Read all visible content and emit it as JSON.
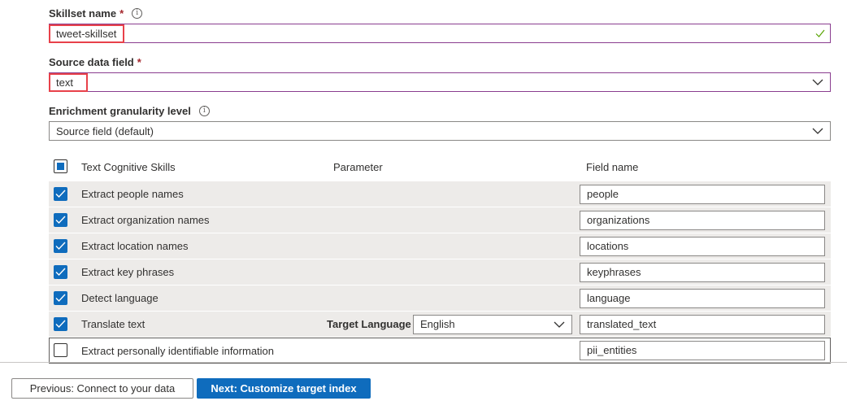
{
  "form": {
    "skillset_name": {
      "label": "Skillset name",
      "required_mark": "*",
      "value": "tweet-skillset"
    },
    "source_data_field": {
      "label": "Source data field",
      "required_mark": "*",
      "value": "text"
    },
    "enrichment_level": {
      "label": "Enrichment granularity level",
      "value": "Source field (default)"
    }
  },
  "table": {
    "headers": {
      "skills": "Text Cognitive Skills",
      "parameter": "Parameter",
      "field_name": "Field name"
    },
    "rows": [
      {
        "skill": "Extract people names",
        "checked": true,
        "field": "people"
      },
      {
        "skill": "Extract organization names",
        "checked": true,
        "field": "organizations"
      },
      {
        "skill": "Extract location names",
        "checked": true,
        "field": "locations"
      },
      {
        "skill": "Extract key phrases",
        "checked": true,
        "field": "keyphrases"
      },
      {
        "skill": "Detect language",
        "checked": true,
        "field": "language"
      },
      {
        "skill": "Translate text",
        "checked": true,
        "field": "translated_text",
        "param_label": "Target Language",
        "param_value": "English"
      },
      {
        "skill": "Extract personally identifiable information",
        "checked": false,
        "field": "pii_entities"
      }
    ]
  },
  "footer": {
    "previous_label": "Previous: Connect to your data",
    "next_label": "Next: Customize target index"
  },
  "colors": {
    "accent": "#0f6cbd",
    "highlight": "#e8414a",
    "focus_border": "#8a3d8f",
    "valid_check": "#57a300"
  },
  "icons": {
    "info": "info-icon",
    "valid": "checkmark-icon",
    "dropdown": "chevron-down-icon"
  }
}
